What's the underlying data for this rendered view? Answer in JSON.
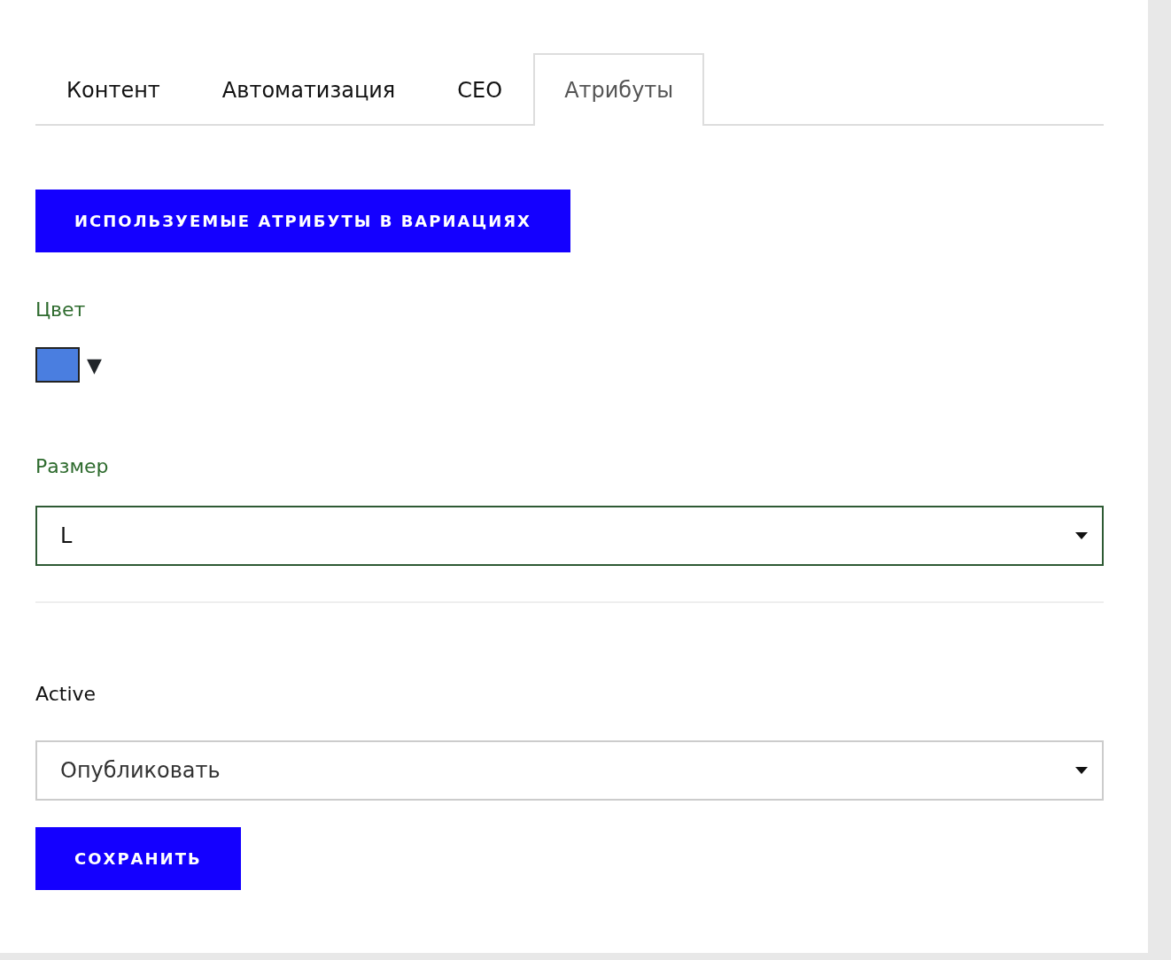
{
  "tabs": [
    {
      "label": "Контент",
      "selected": false
    },
    {
      "label": "Автоматизация",
      "selected": false
    },
    {
      "label": "CEO",
      "selected": false
    },
    {
      "label": "Атрибуты",
      "selected": true
    }
  ],
  "variations_button": "ИСПОЛЬЗУЕМЫЕ АТРИБУТЫ В ВАРИАЦИЯХ",
  "attributes": [
    {
      "kind": "color",
      "label": "Цвет",
      "color": "#4a7ee0",
      "glyph": "▼"
    },
    {
      "kind": "select",
      "label": "Размер",
      "value": "L"
    }
  ],
  "active": {
    "label": "Active",
    "value": "Опубликовать"
  },
  "save_button": "СОХРАНИТЬ"
}
